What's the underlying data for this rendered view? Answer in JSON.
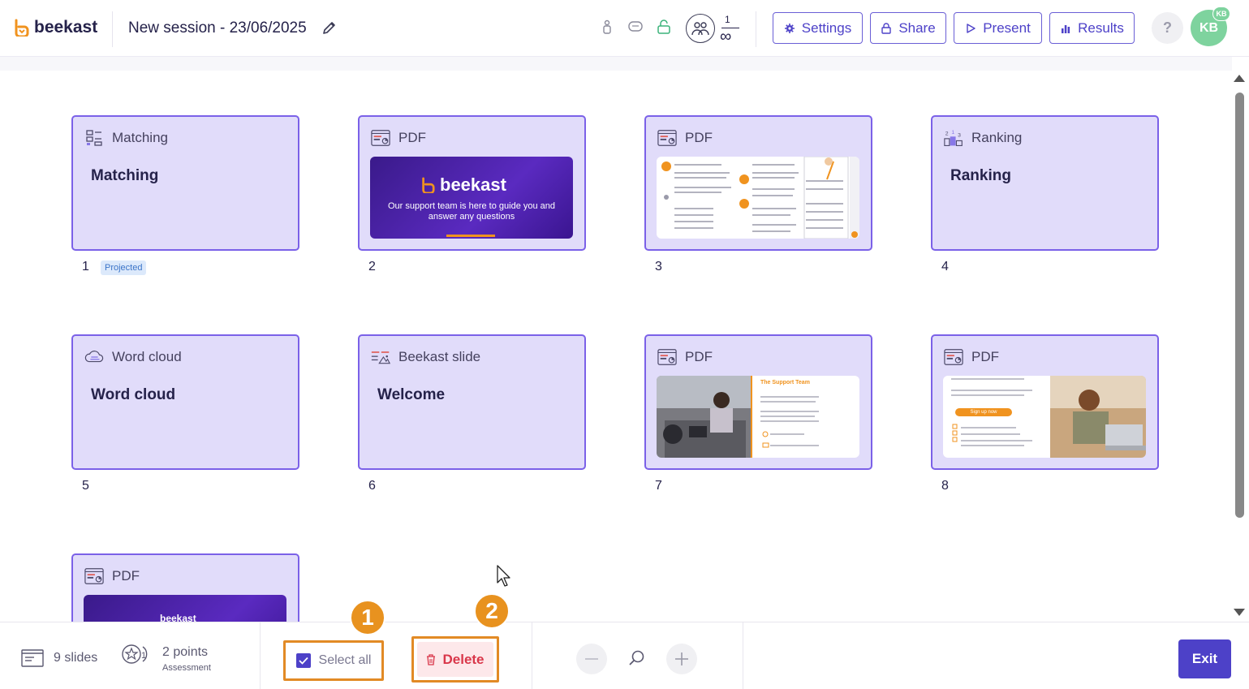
{
  "app": {
    "logo_text": "beekast",
    "brand_color": "#4d41c8",
    "accent_color": "#7b61e8",
    "highlight_color": "#e28a25"
  },
  "header": {
    "session_title": "New session - 23/06/2025",
    "participants": {
      "current": "1",
      "max": "∞"
    },
    "buttons": {
      "settings": "Settings",
      "share": "Share",
      "present": "Present",
      "results": "Results"
    },
    "help": "?",
    "avatar_initials": "KB",
    "avatar_badge": "KB"
  },
  "slides": [
    {
      "number": "1",
      "type": "Matching",
      "title": "Matching",
      "icon": "matching-icon",
      "badge": "Projected"
    },
    {
      "number": "2",
      "type": "PDF",
      "icon": "pdf-icon",
      "thumb": {
        "brand": "beekast",
        "text": "Our support team is here to guide you and answer any questions"
      }
    },
    {
      "number": "3",
      "type": "PDF",
      "icon": "pdf-icon"
    },
    {
      "number": "4",
      "type": "Ranking",
      "title": "Ranking",
      "icon": "ranking-icon"
    },
    {
      "number": "5",
      "type": "Word cloud",
      "title": "Word cloud",
      "icon": "word-cloud-icon"
    },
    {
      "number": "6",
      "type": "Beekast slide",
      "title": "Welcome",
      "icon": "beekast-slide-icon"
    },
    {
      "number": "7",
      "type": "PDF",
      "icon": "pdf-icon",
      "thumb": {
        "heading": "The Support Team"
      }
    },
    {
      "number": "8",
      "type": "PDF",
      "icon": "pdf-icon",
      "thumb": {
        "button": "Sign up now"
      }
    },
    {
      "number": "9",
      "type": "PDF",
      "icon": "pdf-icon",
      "thumb": {
        "brand": "beekast"
      }
    }
  ],
  "footer": {
    "slides_count": "9 slides",
    "points_value": "2 points",
    "points_label": "Assessment",
    "select_all": "Select all",
    "delete": "Delete",
    "exit": "Exit"
  },
  "annotations": {
    "step1": "1",
    "step2": "2"
  }
}
